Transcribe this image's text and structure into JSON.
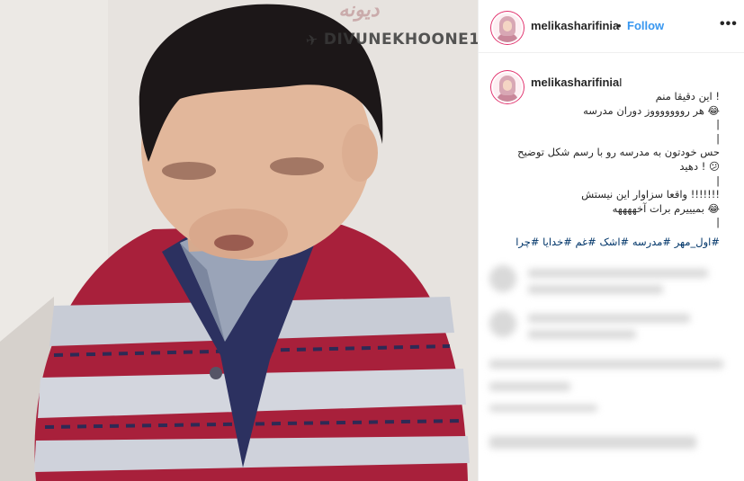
{
  "media": {
    "watermark_logo": "ديونه",
    "watermark_channel": "DIVUNEKHOONE1",
    "telegram_icon": "telegram-icon"
  },
  "header": {
    "username": "melikasharifinia",
    "separator": "•",
    "follow_label": "Follow",
    "more_icon": "more-options-icon"
  },
  "caption": {
    "username": "melikasharifinia",
    "marker": "I",
    "lines": [
      "! این دقیقا منم",
      "😂 هر روووووووز دوران مدرسه",
      "|",
      "|",
      "حس خودتون به مدرسه رو با رسم شکل توضیح",
      "😕 ! دهید",
      "|",
      "!!!!!!! واقعا سزاوار این نیستش",
      "😂 بمیییرم برات آخههههه",
      "|"
    ],
    "hashtags": "#اول_مهر #مدرسه #اشک #غم #خدایا #چرا"
  }
}
